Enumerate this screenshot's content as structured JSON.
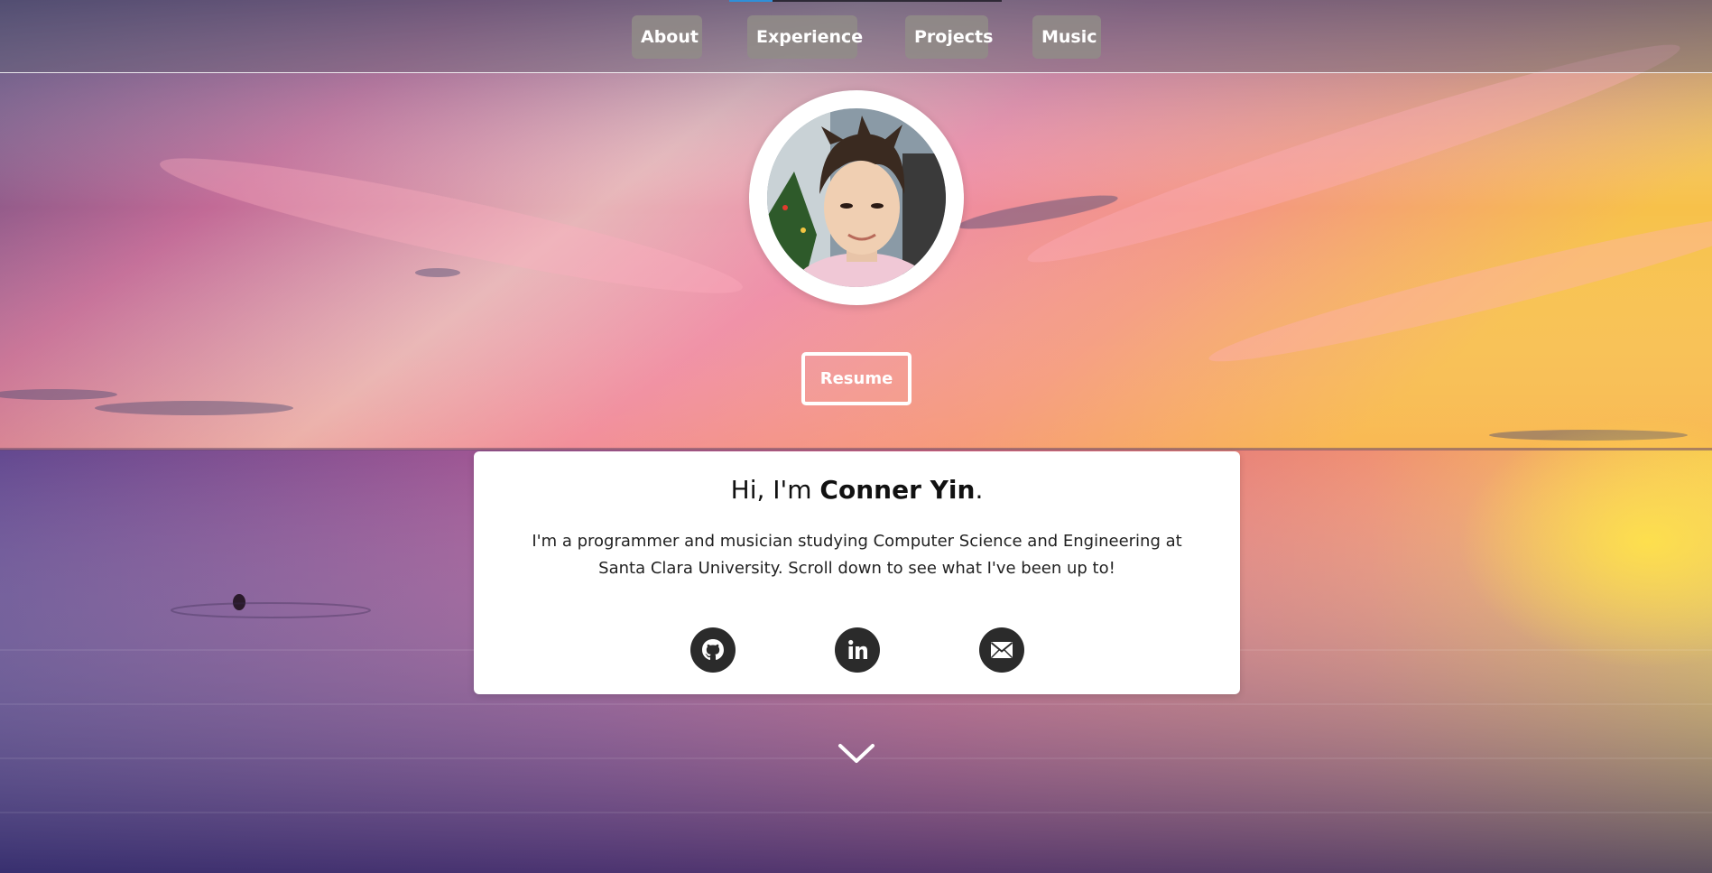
{
  "nav": {
    "scroll_progress": 0.16,
    "items": [
      {
        "label": "About"
      },
      {
        "label": "Experience"
      },
      {
        "label": "Projects"
      },
      {
        "label": "Music"
      }
    ]
  },
  "hero": {
    "resume_label": "Resume",
    "greeting_prefix": "Hi, I'm ",
    "name": "Conner Yin",
    "greeting_suffix": ".",
    "bio": "I'm a programmer and musician studying Computer Science and Engineering at Santa Clara University. Scroll down to see what I've been up to!",
    "social": [
      {
        "icon": "github-icon"
      },
      {
        "icon": "linkedin-icon"
      },
      {
        "icon": "email-icon"
      }
    ]
  },
  "colors": {
    "nav_bg": "#8f8a86",
    "card_bg": "#ffffff",
    "social_icon_bg": "#2b2b2b",
    "progress_accent": "#2f8fd8"
  }
}
